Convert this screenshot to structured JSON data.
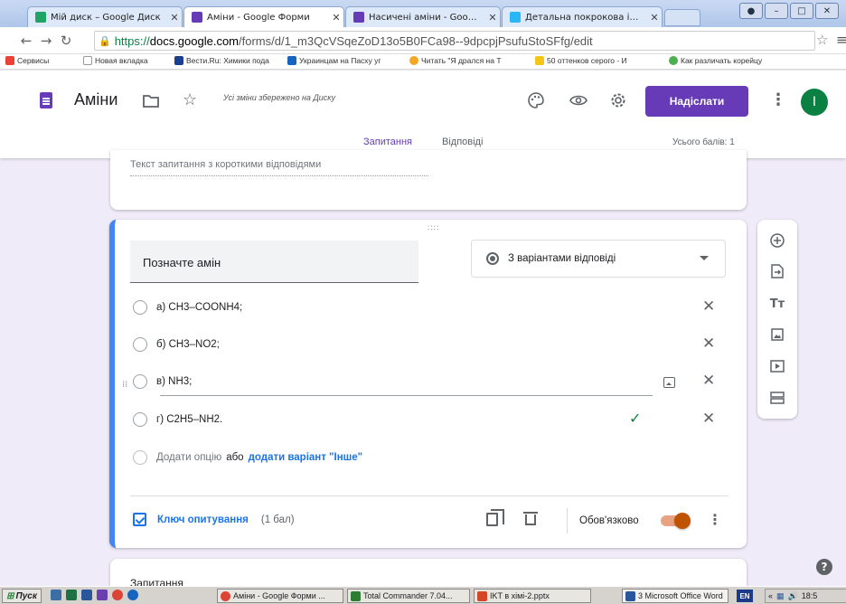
{
  "browser": {
    "tabs": [
      {
        "title": "Мій диск – Google Диск",
        "color": "#1fa463"
      },
      {
        "title": "Аміни - Google Форми",
        "color": "#673ab7"
      },
      {
        "title": "Насичені аміни - Google Фор",
        "color": "#673ab7"
      },
      {
        "title": "Детальна покрокова інстр",
        "color": "#29b6f6"
      }
    ],
    "url_https": "https://",
    "url_host": "docs.google.com",
    "url_path": "/forms/d/1_m3QcVSqeZoD13o5B0FCa98--9dpcpjPsufuStoSFfg/edit",
    "bookmarks": [
      {
        "label": "Сервисы",
        "color": "#ea4335"
      },
      {
        "label": "Новая вкладка",
        "color": "#ffffff"
      },
      {
        "label": "Вести.Ru: Химики пода",
        "color": "#1a3f8c"
      },
      {
        "label": "Украинцам на Пасху уг",
        "color": "#1565c0"
      },
      {
        "label": "Читать \"Я дрался на Т",
        "color": "#f5a623"
      },
      {
        "label": "50 оттенков серого - И",
        "color": "#f5c518"
      },
      {
        "label": "Как различать корейцу",
        "color": "#4caf50"
      }
    ]
  },
  "header": {
    "title": "Аміни",
    "saved_message": "Усі зміни збережено на Диску",
    "send_label": "Надіслати",
    "avatar_letter": "I",
    "tabs": {
      "questions": "Запитання",
      "answers": "Відповіді"
    },
    "total_points": "Усього балів: 1"
  },
  "card_prev": {
    "placeholder": "Текст запитання з короткими відповідями"
  },
  "question": {
    "title": "Позначте амін",
    "type": "З варіантами відповіді",
    "options": [
      {
        "label": "а) CH3–COONH4;",
        "correct": false
      },
      {
        "label": "б) CH3–NO2;",
        "correct": false
      },
      {
        "label": "в) NH3;",
        "correct": false
      },
      {
        "label": "г) C2H5–NH2.",
        "correct": true
      }
    ],
    "add_option": "Додати опцію",
    "add_or": "або",
    "add_other": "додати варіант \"Інше\"",
    "answer_key": "Ключ опитування",
    "points": "(1 бал)",
    "required_label": "Обов'язково",
    "required": true
  },
  "next_card": {
    "label": "Запитання"
  },
  "taskbar": {
    "start": "Пуск",
    "items": [
      {
        "label": "Аміни - Google Форми ...",
        "color": "#db4437"
      },
      {
        "label": "Total Commander 7.04...",
        "color": "#2e7d32"
      },
      {
        "label": "IKT в хімі-2.pptx",
        "color": "#d24726"
      },
      {
        "label": "3 Microsoft Office Word",
        "color": "#2b579a"
      }
    ],
    "lang": "EN",
    "clock": "18:5"
  }
}
